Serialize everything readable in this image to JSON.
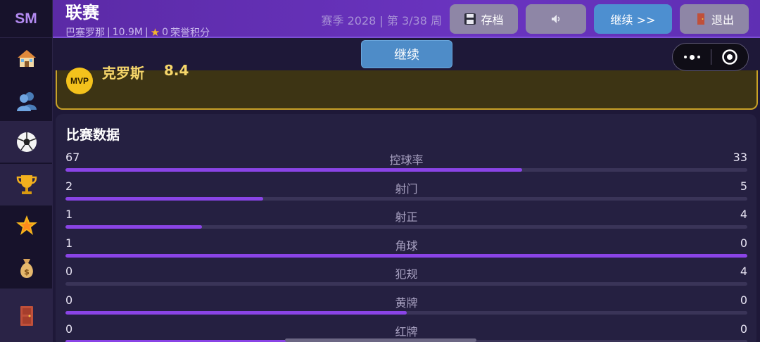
{
  "app": {
    "logo": "SM"
  },
  "header": {
    "title": "联赛",
    "club": "巴塞罗那",
    "value": "10.9M",
    "honor_points": "0",
    "honor_label": "荣誉积分",
    "season_info": "赛季 2028 | 第 3/38 周"
  },
  "toolbar": {
    "save_label": "存档",
    "continue_label": "继续  >>",
    "exit_label": "退出"
  },
  "overlay": {
    "continue_label": "继续"
  },
  "sidebar": {
    "items": [
      {
        "icon": "home-icon"
      },
      {
        "icon": "players-icon"
      },
      {
        "icon": "football-icon"
      },
      {
        "icon": "trophy-icon"
      },
      {
        "icon": "star-icon"
      },
      {
        "icon": "money-bag-icon"
      },
      {
        "icon": "exit-door-icon"
      }
    ]
  },
  "mvp": {
    "badge": "MVP",
    "name": "克罗斯",
    "rating": "8.4"
  },
  "match_stats": {
    "title": "比赛数据",
    "rows": [
      {
        "label": "控球率",
        "home": "67",
        "away": "33",
        "home_share": 0.67
      },
      {
        "label": "射门",
        "home": "2",
        "away": "5",
        "home_share": 0.29
      },
      {
        "label": "射正",
        "home": "1",
        "away": "4",
        "home_share": 0.2
      },
      {
        "label": "角球",
        "home": "1",
        "away": "0",
        "home_share": 1.0
      },
      {
        "label": "犯规",
        "home": "0",
        "away": "4",
        "home_share": 0.0
      },
      {
        "label": "黄牌",
        "home": "0",
        "away": "0",
        "home_share": 0.5
      },
      {
        "label": "红牌",
        "home": "0",
        "away": "0",
        "home_share": 0.5
      }
    ]
  },
  "colors": {
    "accent": "#6a34c0",
    "bar_fill": "#8a44e6",
    "mvp_gold": "#f4c21c",
    "button_blue": "#4d8fd0"
  }
}
